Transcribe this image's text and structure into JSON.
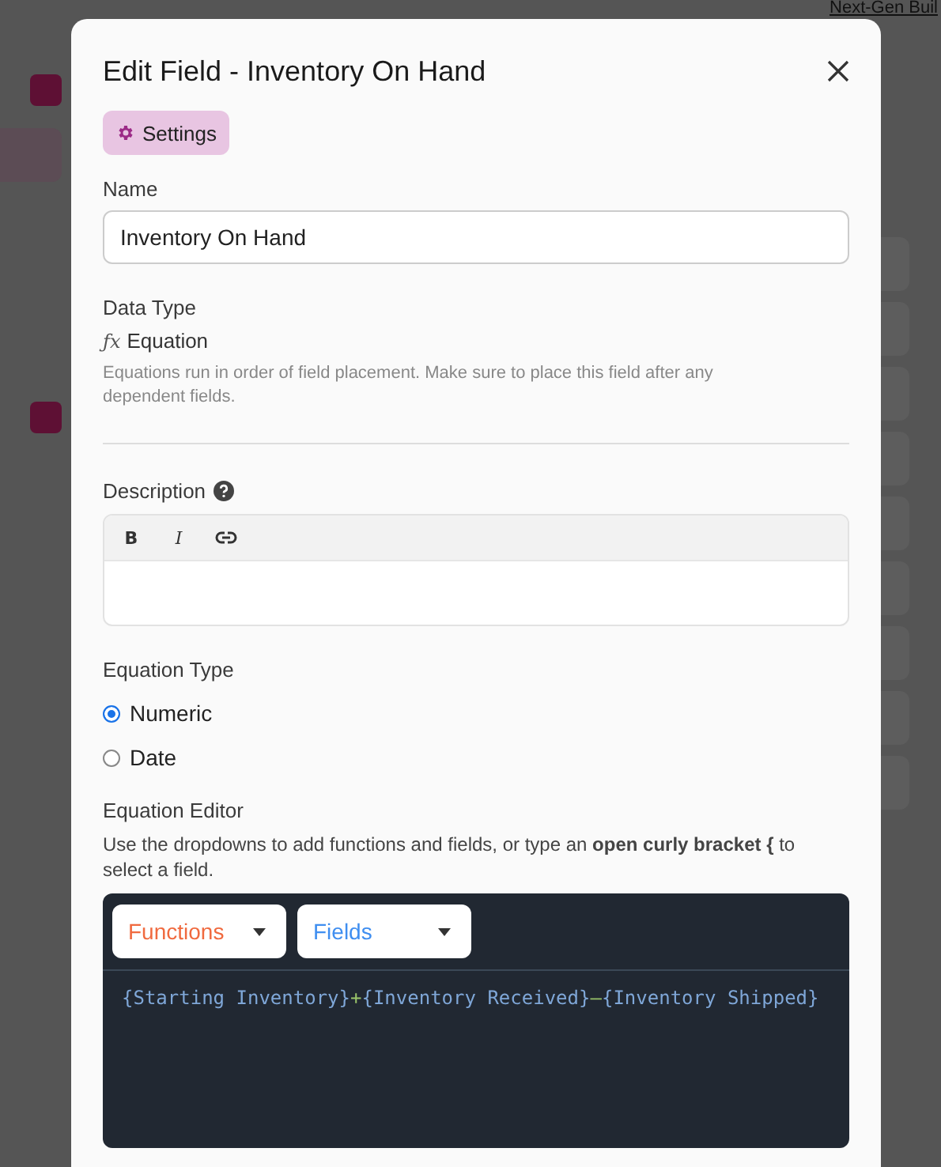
{
  "background": {
    "header_text": "Next-Gen Buil"
  },
  "dialog": {
    "title": "Edit Field - Inventory On Hand",
    "tabs": [
      {
        "label": "Settings",
        "selected": true
      }
    ],
    "name": {
      "label": "Name",
      "value": "Inventory On Hand"
    },
    "data_type": {
      "label": "Data Type",
      "icon": "ƒx",
      "value": "Equation",
      "hint": "Equations run in order of field placement. Make sure to place this field after any dependent fields."
    },
    "description": {
      "label": "Description",
      "toolbar": [
        {
          "kind": "bold",
          "label": "B"
        },
        {
          "kind": "italic",
          "label": "I"
        },
        {
          "kind": "link"
        }
      ]
    },
    "equation_type": {
      "label": "Equation Type",
      "options": [
        {
          "label": "Numeric",
          "selected": true
        },
        {
          "label": "Date",
          "selected": false
        }
      ]
    },
    "equation_editor": {
      "label": "Equation Editor",
      "hint": "Use the dropdowns to add functions and fields, or type an **open curly bracket {** to select a field.",
      "dropdowns": [
        {
          "kind": "functions",
          "label": "Functions"
        },
        {
          "kind": "fields",
          "label": "Fields"
        }
      ],
      "tokens": [
        {
          "kind": "field",
          "text": "{Starting Inventory}"
        },
        {
          "kind": "operator",
          "text": "+"
        },
        {
          "kind": "field",
          "text": "{Inventory Received}"
        },
        {
          "kind": "operator",
          "text": "–"
        },
        {
          "kind": "field",
          "text": "{Inventory Shipped}"
        }
      ]
    }
  }
}
